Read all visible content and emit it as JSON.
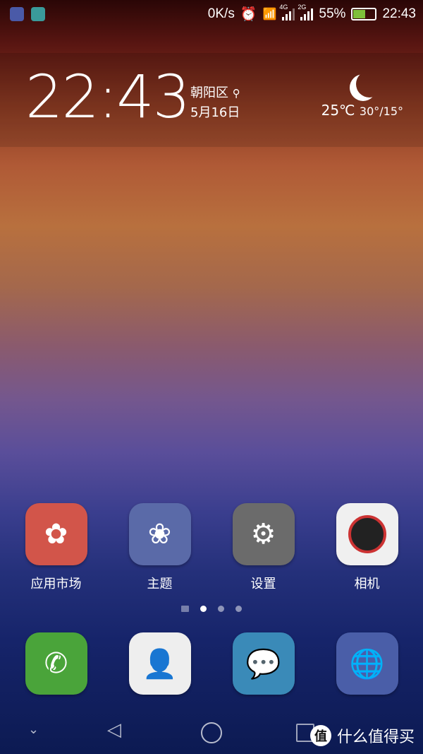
{
  "status_bar": {
    "notifications": [
      "health-icon",
      "gallery-icon"
    ],
    "net_speed": "0K/s",
    "sim1": "4G",
    "sim2": "2G",
    "battery": "55%",
    "battery_level": 0.55,
    "time": "22:43"
  },
  "widget": {
    "time": "22:43",
    "location": "朝阳区",
    "date": "5月16日",
    "weather_icon": "moon-icon",
    "temp": "25℃",
    "range": "30°/15°"
  },
  "apps": [
    {
      "label": "应用市场",
      "color": "#d2554a"
    },
    {
      "label": "主题",
      "color": "#5a6aa8"
    },
    {
      "label": "设置",
      "color": "#6b6b6b"
    },
    {
      "label": "相机",
      "color": "#f0f0f0"
    }
  ],
  "dock": [
    {
      "name": "phone",
      "color": "#4aa43a"
    },
    {
      "name": "contacts",
      "color": "#eeeeee"
    },
    {
      "name": "messages",
      "color": "#3a8ab8"
    },
    {
      "name": "browser",
      "color": "#4a5ea8"
    }
  ],
  "page_indicator": {
    "pages": 3,
    "current": 1
  },
  "watermark": {
    "badge": "值",
    "text": "什么值得买"
  }
}
